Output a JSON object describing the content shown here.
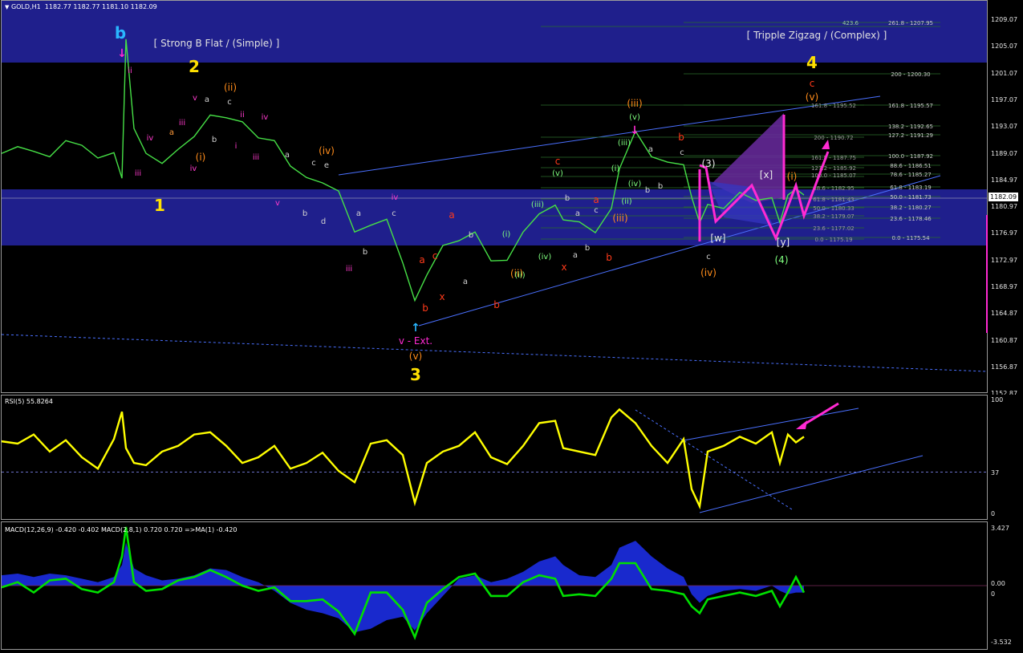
{
  "header": {
    "symbol": "GOLD,H1",
    "ohlc": "1182.77 1182.77 1181.10 1182.09",
    "current_price": "1182.09"
  },
  "colors": {
    "zone": "#1f1f8c",
    "price": "#46e046",
    "rsi": "#ffff00",
    "macd_line": "#00e000",
    "macd_hist": "#1a2bd8",
    "channel": "#4a70ff",
    "magenta": "#ff2ad2",
    "orange": "#ff8c1a",
    "red": "#ff3a1a",
    "yellow": "#ffe000",
    "cyan": "#29b6ff"
  },
  "main_chart": {
    "price_ticks": [
      "1209.07",
      "1205.07",
      "1201.07",
      "1197.07",
      "1193.07",
      "1189.07",
      "1184.97",
      "1180.97",
      "1176.97",
      "1172.97",
      "1168.97",
      "1164.87",
      "1160.87",
      "1156.87",
      "1152.87"
    ],
    "titles": {
      "left": "[ Strong B Flat / (Simple) ]",
      "right": "[ Tripple Zigzag / (Complex) ]"
    },
    "fib_right": [
      "423.6",
      "261.8 - 1207.95",
      "200 - 1200.30",
      "161.8 - 1195.57",
      "138.2 - 1192.65",
      "127.2 - 1191.29",
      "100.0 - 1187.92",
      "88.6 - 1186.51",
      "78.6 - 1185.27",
      "61.8 - 1183.19",
      "50.0 - 1181.73",
      "38.2 - 1180.27",
      "23.6 - 1178.46",
      "0.0 - 1175.54"
    ],
    "fib_mid": [
      "161.8 - 1195.52",
      "200 - 1190.72",
      "161.8 - 1187.75",
      "127.2 - 1185.92",
      "100.0 - 1185.07",
      "88.6 - 1182.95",
      "61.8 - 1181.43",
      "50.0 - 1180.33",
      "38.2 - 1179.07",
      "23.6 - 1177.02",
      "0.0 - 1175.19"
    ],
    "wave_labels": [
      {
        "t": "b",
        "c": "cyan",
        "big": true
      },
      {
        "t": "2",
        "c": "yellow",
        "big": true
      },
      {
        "t": "1",
        "c": "yellow",
        "big": true
      },
      {
        "t": "3",
        "c": "yellow",
        "big": true
      },
      {
        "t": "4",
        "c": "yellow",
        "big": true
      },
      {
        "t": "(ii)",
        "c": "orange"
      },
      {
        "t": "(i)",
        "c": "orange"
      },
      {
        "t": "(iii)",
        "c": "orange"
      },
      {
        "t": "(iv)",
        "c": "orange"
      },
      {
        "t": "(v)",
        "c": "orange"
      },
      {
        "t": "(iii)",
        "c": "orange"
      },
      {
        "t": "(v)",
        "c": "orange"
      },
      {
        "t": "(ii)",
        "c": "orange"
      },
      {
        "t": "(iv)",
        "c": "orange"
      },
      {
        "t": "(3)",
        "c": "white"
      },
      {
        "t": "(4)",
        "c": "lightgreen"
      },
      {
        "t": "a",
        "c": "red"
      },
      {
        "t": "b",
        "c": "red"
      },
      {
        "t": "c",
        "c": "red"
      },
      {
        "t": "x",
        "c": "red"
      },
      {
        "t": "a",
        "c": "red"
      },
      {
        "t": "b",
        "c": "red"
      },
      {
        "t": "c",
        "c": "red"
      },
      {
        "t": "x",
        "c": "red"
      },
      {
        "t": "a",
        "c": "red"
      },
      {
        "t": "b",
        "c": "red"
      },
      {
        "t": "b",
        "c": "red"
      },
      {
        "t": "c",
        "c": "red"
      },
      {
        "t": "c",
        "c": "red"
      },
      {
        "t": "[w]",
        "c": "white"
      },
      {
        "t": "[x]",
        "c": "white"
      },
      {
        "t": "[y]",
        "c": "white"
      },
      {
        "t": "(i)",
        "c": "orange"
      },
      {
        "t": "v - Ext.",
        "c": "magenta"
      }
    ]
  },
  "rsi_panel": {
    "label": "RSI(5) 55.8264",
    "ticks": [
      "100",
      "37",
      "0"
    ]
  },
  "macd_panel": {
    "label": "MACD(12,26,9) -0.420 -0.402  MACD(2,8,1) 0.720 0.720  =>MA(1) -0.420",
    "ticks": [
      "3.427",
      "0.00",
      "0",
      "-3.532"
    ]
  },
  "chart_data": {
    "type": "line",
    "title": "",
    "instrument": "GOLD,H1",
    "ylim": [
      1152.87,
      1211.0
    ],
    "grid": false,
    "x": [
      0,
      20,
      40,
      60,
      80,
      100,
      120,
      140,
      150,
      155,
      165,
      180,
      200,
      220,
      240,
      260,
      280,
      300,
      320,
      340,
      360,
      380,
      400,
      420,
      440,
      460,
      480,
      500,
      515,
      530,
      550,
      570,
      590,
      610,
      630,
      650,
      670,
      690,
      700,
      720,
      740,
      760,
      770,
      790,
      810,
      830,
      850,
      860,
      870,
      880,
      900,
      920,
      940,
      960,
      970,
      980,
      990,
      1000
    ],
    "series": [
      {
        "name": "price",
        "values": [
          1188.3,
          1189.3,
          1188.6,
          1187.8,
          1190.2,
          1189.5,
          1187.6,
          1188.4,
          1184.6,
          1205.3,
          1192.0,
          1188.3,
          1186.8,
          1188.9,
          1190.8,
          1194.0,
          1193.6,
          1193.0,
          1190.6,
          1190.2,
          1186.4,
          1184.7,
          1183.9,
          1182.7,
          1176.6,
          1177.6,
          1178.5,
          1172.0,
          1166.4,
          1170.2,
          1174.6,
          1175.3,
          1176.6,
          1172.3,
          1172.4,
          1176.6,
          1179.3,
          1180.6,
          1178.4,
          1178.1,
          1176.5,
          1180.1,
          1186.0,
          1191.6,
          1187.8,
          1187.0,
          1186.6,
          1181.8,
          1178.0,
          1180.7,
          1180.1,
          1182.5,
          1181.3,
          1181.7,
          1178.0,
          1182.1,
          1183.0,
          1182.1
        ]
      },
      {
        "name": "RSI",
        "values": [
          64,
          62,
          70,
          55,
          65,
          50,
          40,
          66,
          90,
          58,
          45,
          43,
          55,
          60,
          70,
          72,
          60,
          45,
          50,
          60,
          40,
          45,
          54,
          38,
          28,
          62,
          65,
          52,
          10,
          45,
          55,
          60,
          72,
          50,
          44,
          60,
          80,
          82,
          58,
          55,
          52,
          85,
          92,
          80,
          60,
          45,
          66,
          22,
          7,
          55,
          60,
          68,
          62,
          72,
          45,
          70,
          63,
          68
        ]
      },
      {
        "name": "MACD histogram",
        "values": [
          0.6,
          0.7,
          0.5,
          0.7,
          0.6,
          0.4,
          0.2,
          0.5,
          1.2,
          2.5,
          1.0,
          0.6,
          0.3,
          0.4,
          0.6,
          1.0,
          0.9,
          0.5,
          0.2,
          -0.3,
          -1.0,
          -1.4,
          -1.6,
          -1.9,
          -2.7,
          -2.5,
          -2.0,
          -1.8,
          -2.6,
          -1.6,
          -0.6,
          0.4,
          0.6,
          0.2,
          0.4,
          0.8,
          1.4,
          1.7,
          1.2,
          0.6,
          0.5,
          1.2,
          2.2,
          2.6,
          1.7,
          1.0,
          0.5,
          -0.5,
          -1.0,
          -0.6,
          -0.3,
          -0.2,
          -0.3,
          0.0,
          -0.3,
          -0.5,
          -0.4,
          -0.4
        ]
      },
      {
        "name": "MACD(2,8,1)",
        "values": [
          -0.1,
          0.2,
          -0.4,
          0.3,
          0.4,
          -0.2,
          -0.4,
          0.2,
          1.7,
          3.4,
          0.2,
          -0.3,
          -0.2,
          0.3,
          0.5,
          0.9,
          0.5,
          0.0,
          -0.3,
          -0.1,
          -0.9,
          -0.9,
          -0.8,
          -1.5,
          -2.8,
          -0.4,
          -0.4,
          -1.4,
          -3.0,
          -1.0,
          -0.2,
          0.5,
          0.7,
          -0.6,
          -0.6,
          0.2,
          0.6,
          0.4,
          -0.6,
          -0.5,
          -0.6,
          0.4,
          1.3,
          1.3,
          -0.2,
          -0.3,
          -0.5,
          -1.2,
          -1.6,
          -0.8,
          -0.6,
          -0.4,
          -0.6,
          -0.3,
          -1.2,
          -0.4,
          0.5,
          -0.4
        ]
      }
    ]
  }
}
